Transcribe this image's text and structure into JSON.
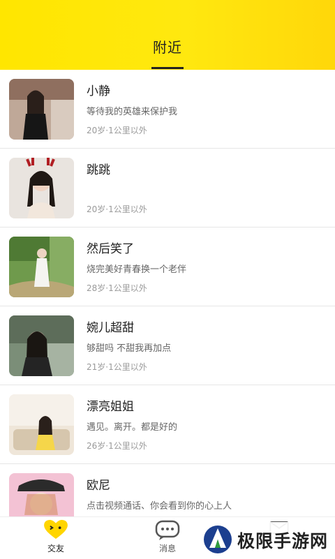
{
  "header": {
    "tab_label": "附近",
    "bg_color": "#ffe600"
  },
  "users": [
    {
      "name": "小静",
      "bio": "等待我的英雄来保护我",
      "meta": "20岁·1公里以外"
    },
    {
      "name": "跳跳",
      "bio": "",
      "meta": "20岁·1公里以外"
    },
    {
      "name": "然后笑了",
      "bio": "烧完美好青春换一个老伴",
      "meta": "28岁·1公里以外"
    },
    {
      "name": "婉儿超甜",
      "bio": "够甜吗 不甜我再加点",
      "meta": "21岁·1公里以外"
    },
    {
      "name": "漂亮姐姐",
      "bio": "遇见。离开。都是好的",
      "meta": "26岁·1公里以外"
    },
    {
      "name": "欧尼",
      "bio": "点击视频通话、你会看到你的心上人",
      "meta": ""
    }
  ],
  "tabbar": {
    "items": [
      {
        "label": "交友",
        "icon": "heart-face-icon"
      },
      {
        "label": "消息",
        "icon": "chat-bubble-icon"
      },
      {
        "label": "",
        "icon": "mail-icon"
      }
    ]
  },
  "watermark": {
    "text": "极限手游网"
  }
}
